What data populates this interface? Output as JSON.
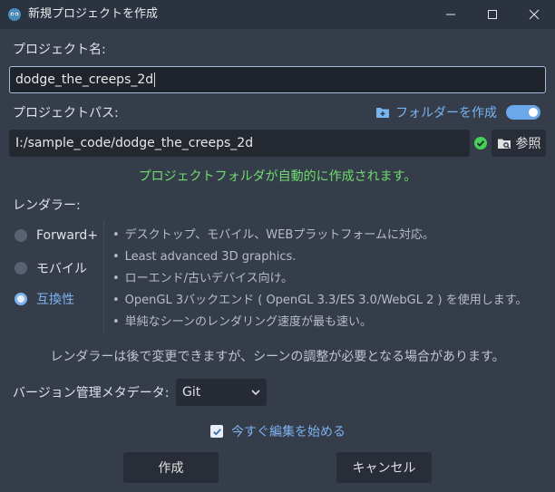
{
  "window": {
    "title": "新規プロジェクトを作成",
    "icon": "godot-icon",
    "controls": {
      "minimize": "minimize-icon",
      "maximize": "maximize-icon",
      "close": "close-icon"
    }
  },
  "project_name": {
    "label": "プロジェクト名:",
    "value": "dodge_the_creeps_2d"
  },
  "project_path": {
    "label": "プロジェクトパス:",
    "create_folder_label": "フォルダーを作成",
    "create_folder_enabled": true,
    "value": "I:/sample_code/dodge_the_creeps_2d",
    "browse_label": "参照",
    "status_message": "プロジェクトフォルダが自動的に作成されます。"
  },
  "renderer": {
    "label": "レンダラー:",
    "options": [
      {
        "label": "Forward+",
        "selected": false
      },
      {
        "label": "モバイル",
        "selected": false
      },
      {
        "label": "互換性",
        "selected": true
      }
    ],
    "features": [
      "デスクトップ、モバイル、WEBプラットフォームに対応。",
      "Least advanced 3D graphics.",
      "ローエンド/古いデバイス向け。",
      "OpenGL 3バックエンド ( OpenGL 3.3/ES 3.0/WebGL 2 ) を使用します。",
      "単純なシーンのレンダリング速度が最も速い。"
    ],
    "bullet": "•",
    "note": "レンダラーは後で変更できますが、シーンの調整が必要となる場合があります。"
  },
  "vcs": {
    "label": "バージョン管理メタデータ:",
    "selected": "Git"
  },
  "edit_now": {
    "label": "今すぐ編集を始める",
    "checked": true
  },
  "buttons": {
    "create": "作成",
    "cancel": "キャンセル"
  },
  "colors": {
    "accent": "#78b4f2",
    "success": "#6fdc6f",
    "background": "#363d4a"
  }
}
